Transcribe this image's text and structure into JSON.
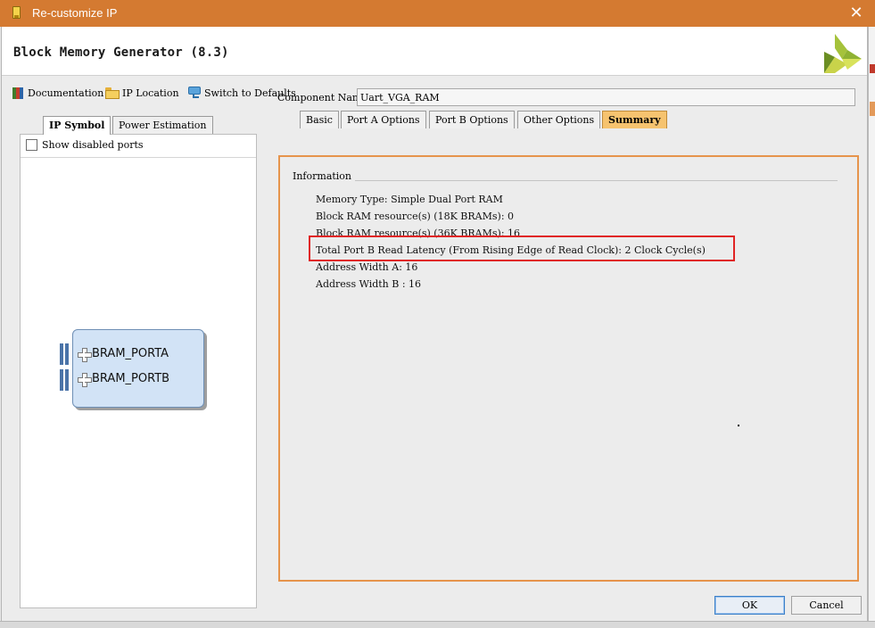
{
  "window": {
    "title": "Re-customize IP",
    "close_label": "✕"
  },
  "header": {
    "title": "Block Memory Generator (8.3)",
    "logo": "xilinx-logo"
  },
  "toolbar": {
    "documentation": "Documentation",
    "ip_location": "IP Location",
    "switch_defaults": "Switch to Defaults"
  },
  "left_panel": {
    "tabs": [
      {
        "label": "IP Symbol"
      },
      {
        "label": "Power Estimation"
      }
    ],
    "show_disabled_ports": "Show disabled ports",
    "ports": [
      {
        "label": "BRAM_PORTA"
      },
      {
        "label": "BRAM_PORTB"
      }
    ]
  },
  "component": {
    "label": "Component Name",
    "value": "Uart_VGA_RAM"
  },
  "tabs": [
    {
      "label": "Basic"
    },
    {
      "label": "Port A Options"
    },
    {
      "label": "Port B Options"
    },
    {
      "label": "Other Options"
    },
    {
      "label": "Summary"
    }
  ],
  "summary": {
    "section": "Information",
    "lines": [
      "Memory Type: Simple Dual Port RAM",
      "Block RAM resource(s) (18K BRAMs): 0",
      "Block RAM resource(s) (36K BRAMs): 16",
      "Total Port B Read Latency (From Rising Edge of Read Clock): 2 Clock Cycle(s)",
      "Address Width A: 16",
      "Address Width B : 16"
    ]
  },
  "buttons": {
    "ok": "OK",
    "cancel": "Cancel"
  },
  "colors": {
    "title_bar": "#d47a31",
    "active_tab": "#f6c36f",
    "highlight": "#e02424",
    "panel_border": "#e6944c"
  }
}
